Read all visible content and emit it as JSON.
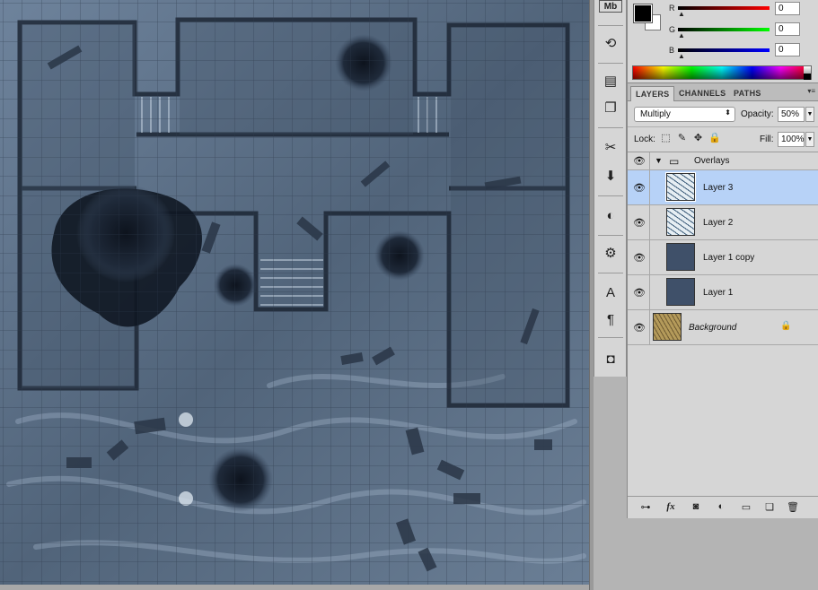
{
  "canvas": {
    "map_colors": {
      "base": "#55677c",
      "light": "#8fa3bb",
      "dark": "#1c2634",
      "grid": "#2e3b4c"
    }
  },
  "tools": {
    "items": [
      {
        "name": "mini-bridge-icon",
        "glyph": "Mb"
      },
      {
        "name": "history-icon",
        "glyph": "⟲"
      },
      {
        "name": "actions-icon",
        "glyph": "▤"
      },
      {
        "name": "notes-icon",
        "glyph": "❐"
      },
      {
        "name": "brush-presets-icon",
        "glyph": "✂"
      },
      {
        "name": "clone-source-icon",
        "glyph": "⬇"
      },
      {
        "name": "adjustments-icon",
        "glyph": "◐"
      },
      {
        "name": "tool-presets-icon",
        "glyph": "⚙"
      },
      {
        "name": "character-icon",
        "glyph": "A"
      },
      {
        "name": "paragraph-icon",
        "glyph": "¶"
      },
      {
        "name": "masks-icon",
        "glyph": "◘"
      }
    ]
  },
  "color": {
    "foreground": "#000000",
    "background": "#ffffff",
    "channels": [
      {
        "label": "R",
        "value": "0",
        "gradient": "linear-gradient(to right,#000,#ff0000)"
      },
      {
        "label": "G",
        "value": "0",
        "gradient": "linear-gradient(to right,#000,#00ff00)"
      },
      {
        "label": "B",
        "value": "0",
        "gradient": "linear-gradient(to right,#000,#0000ff)"
      }
    ]
  },
  "layers_panel": {
    "tabs": [
      {
        "label": "LAYERS",
        "active": true
      },
      {
        "label": "CHANNELS",
        "active": false
      },
      {
        "label": "PATHS",
        "active": false
      }
    ],
    "blend_mode": "Multiply",
    "opacity_label": "Opacity:",
    "opacity_value": "50%",
    "lock_label": "Lock:",
    "fill_label": "Fill:",
    "fill_value": "100%",
    "group": {
      "name": "Overlays"
    },
    "layers": [
      {
        "name": "Layer 3",
        "selected": true,
        "italic": false,
        "thumb": "texture"
      },
      {
        "name": "Layer 2",
        "selected": false,
        "italic": false,
        "thumb": "texture"
      },
      {
        "name": "Layer 1 copy",
        "selected": false,
        "italic": false,
        "thumb": "solid"
      },
      {
        "name": "Layer 1",
        "selected": false,
        "italic": false,
        "thumb": "solid"
      },
      {
        "name": "Background",
        "selected": false,
        "italic": true,
        "thumb": "map",
        "locked": true
      }
    ],
    "thumb_colors": {
      "solid": "#3f5069",
      "texture_a": "#e6eef3",
      "texture_b": "#3a5a78",
      "map_a": "#b49a5a",
      "map_b": "#6e5a32"
    },
    "selected_color": "#b7d2f7",
    "footer_icons": [
      "link-layers-icon",
      "fx-icon",
      "add-mask-icon",
      "adjustment-layer-icon",
      "new-group-icon",
      "new-layer-icon",
      "trash-icon"
    ],
    "footer_glyphs": [
      "⊶",
      "fx",
      "◙",
      "◐",
      "▭",
      "❏",
      "🗑"
    ]
  }
}
